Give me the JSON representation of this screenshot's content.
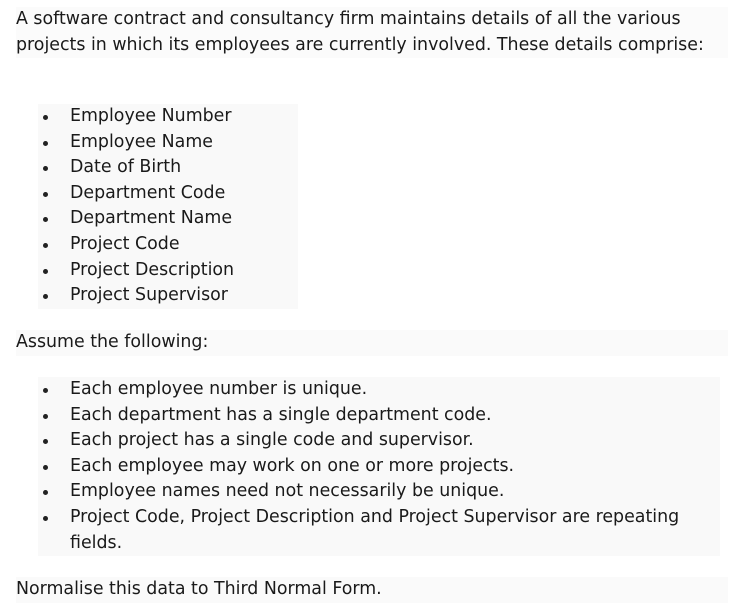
{
  "intro": "A software contract and consultancy firm maintains details of all the various projects in which its employees are currently involved. These details comprise:",
  "fields": [
    "Employee Number",
    "Employee Name",
    "Date of Birth",
    "Department Code",
    "Department Name",
    "Project Code",
    "Project Description",
    "Project Supervisor"
  ],
  "assume_heading": "Assume the following:",
  "assumptions": [
    "Each employee number is unique.",
    "Each department has a single department code.",
    "Each project has a single code and supervisor.",
    "Each employee may work on one or more projects.",
    "Employee names need not necessarily be unique.",
    "Project Code, Project Description and Project Supervisor are repeating fields."
  ],
  "final": "Normalise this data to Third Normal Form."
}
